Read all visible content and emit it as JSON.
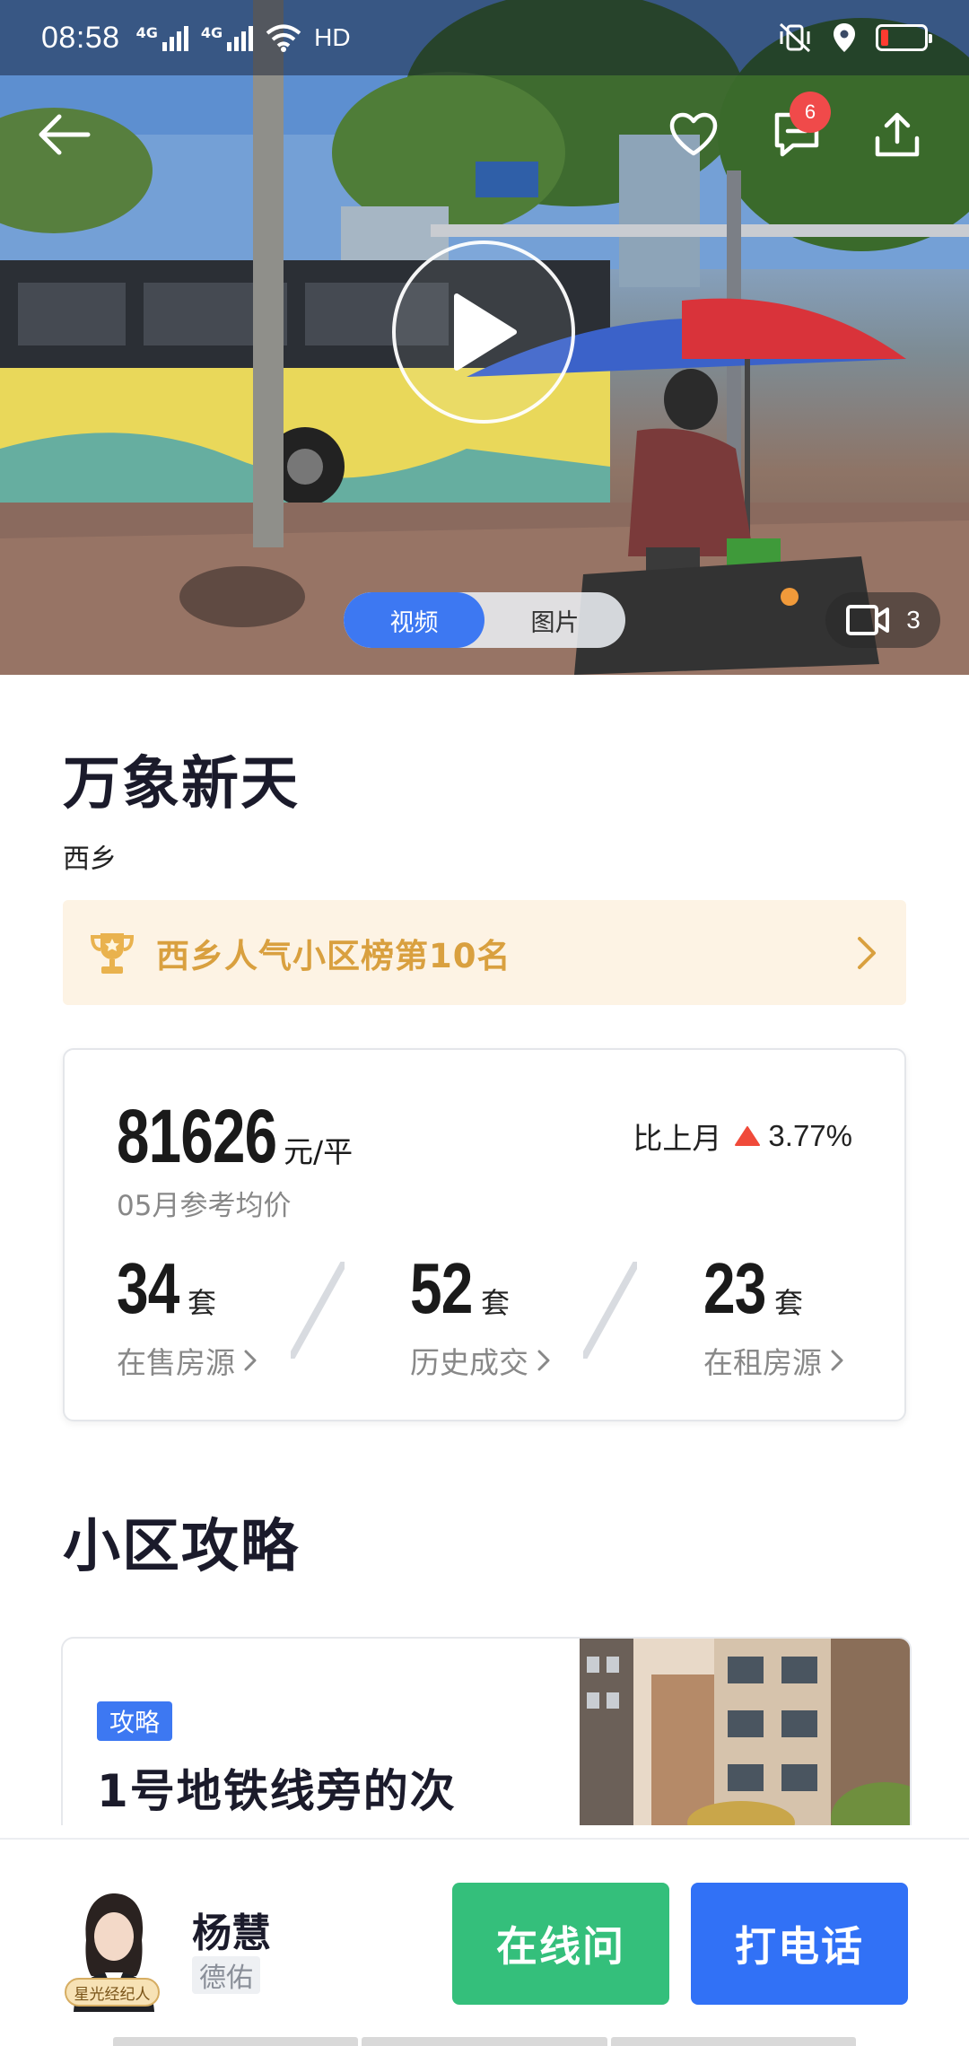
{
  "status_bar": {
    "time": "08:58",
    "signal_1": "4G",
    "signal_2": "4G",
    "hd": "HD",
    "battery_color": "#ff3b30"
  },
  "nav": {
    "back_icon": "arrow-left-icon",
    "favorite_icon": "heart-icon",
    "message_icon": "message-icon",
    "message_badge": "6",
    "share_icon": "share-icon"
  },
  "media": {
    "tabs": [
      {
        "label": "视频",
        "active": true
      },
      {
        "label": "图片",
        "active": false
      }
    ],
    "video_count": "3"
  },
  "community": {
    "name": "万象新天",
    "district": "西乡",
    "ranking": "西乡人气小区榜第10名"
  },
  "price": {
    "value": "81626",
    "unit": "元/平",
    "caption": "05月参考均价",
    "compare_label": "比上月",
    "compare_value": "3.77%",
    "trend": "up"
  },
  "stats": [
    {
      "number": "34",
      "unit": "套",
      "label": "在售房源"
    },
    {
      "number": "52",
      "unit": "套",
      "label": "历史成交"
    },
    {
      "number": "23",
      "unit": "套",
      "label": "在租房源"
    }
  ],
  "guide": {
    "heading": "小区攻略",
    "tag": "攻略",
    "title": "1号地铁线旁的次"
  },
  "agent": {
    "name": "杨慧",
    "company": "德佑",
    "badge": "星光经纪人"
  },
  "actions": {
    "online": "在线问",
    "call": "打电话"
  },
  "colors": {
    "accent_blue": "#3171f6",
    "accent_green": "#34bf7b",
    "ranking_gold": "#d9a03f",
    "trend_red": "#f04a3a"
  }
}
